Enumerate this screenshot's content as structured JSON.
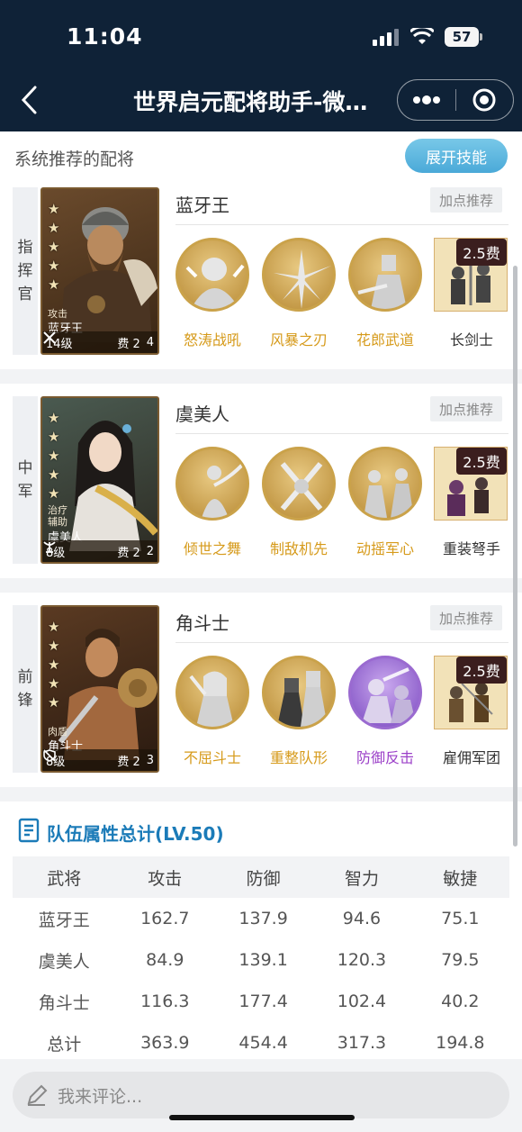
{
  "status_bar": {
    "time": "11:04",
    "battery": "57"
  },
  "nav": {
    "title": "世界启元配将助手-微信小程序",
    "more_icon": "more-dots-icon",
    "close_icon": "target-close-icon"
  },
  "section": {
    "title": "系统推荐的配将",
    "expand_label": "展开技能"
  },
  "recommend_label": "加点推荐",
  "teams": [
    {
      "role": [
        "指",
        "挥",
        "官"
      ],
      "general": {
        "name": "蓝牙王",
        "type_line1": "攻击",
        "type_line2": "",
        "card_name": "蓝牙王",
        "level": "14级",
        "cost": "费 2",
        "weapon_icon": "crossed-swords-icon",
        "weapon_value": "4",
        "stars": 5
      },
      "skills": [
        {
          "name": "怒涛战吼",
          "color": "gold"
        },
        {
          "name": "风暴之刃",
          "color": "gold"
        },
        {
          "name": "花郎武道",
          "color": "gold"
        }
      ],
      "troop": {
        "name": "长剑士",
        "fee": "2.5费"
      }
    },
    {
      "role": [
        "中",
        "军"
      ],
      "general": {
        "name": "虞美人",
        "type_line1": "治疗",
        "type_line2": "辅助",
        "card_name": "虞美人",
        "level": "8级",
        "cost": "费 2",
        "weapon_icon": "bow-icon",
        "weapon_value": "2",
        "stars": 5
      },
      "skills": [
        {
          "name": "倾世之舞",
          "color": "gold"
        },
        {
          "name": "制敌机先",
          "color": "gold"
        },
        {
          "name": "动摇军心",
          "color": "gold"
        }
      ],
      "troop": {
        "name": "重装弩手",
        "fee": "2.5费"
      }
    },
    {
      "role": [
        "前",
        "锋"
      ],
      "general": {
        "name": "角斗士",
        "type_line1": "肉盾",
        "type_line2": "",
        "card_name": "角斗士",
        "level": "8级",
        "cost": "费 2",
        "weapon_icon": "shield-icon",
        "weapon_value": "3",
        "stars": 5
      },
      "skills": [
        {
          "name": "不屈斗士",
          "color": "gold"
        },
        {
          "name": "重整队形",
          "color": "gold"
        },
        {
          "name": "防御反击",
          "color": "purple"
        }
      ],
      "troop": {
        "name": "雇佣军团",
        "fee": "2.5费"
      }
    }
  ],
  "stats": {
    "title": "队伍属性总计(LV.50)",
    "headers": [
      "武将",
      "攻击",
      "防御",
      "智力",
      "敏捷"
    ],
    "rows": [
      [
        "蓝牙王",
        "162.7",
        "137.9",
        "94.6",
        "75.1"
      ],
      [
        "虞美人",
        "84.9",
        "139.1",
        "120.3",
        "79.5"
      ],
      [
        "角斗士",
        "116.3",
        "177.4",
        "102.4",
        "40.2"
      ],
      [
        "总计",
        "363.9",
        "454.4",
        "317.3",
        "194.8"
      ]
    ]
  },
  "comment": {
    "placeholder": "我来评论..."
  },
  "colors": {
    "header_bg": "#0f2237",
    "accent_blue": "#4aa9d8",
    "skill_gold": "#d69a1a",
    "skill_purple": "#9b3fc8"
  }
}
